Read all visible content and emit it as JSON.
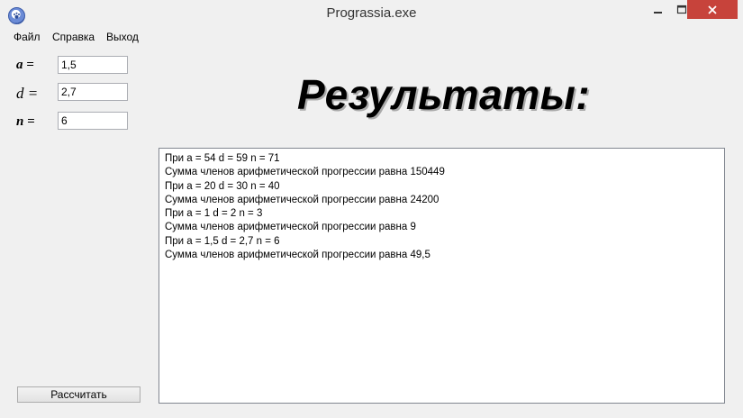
{
  "window": {
    "title": "Prograssia.exe"
  },
  "menu": {
    "items": [
      {
        "label": "Файл"
      },
      {
        "label": "Справка"
      },
      {
        "label": "Выход"
      }
    ]
  },
  "inputs": {
    "a": {
      "label": "a =",
      "value": "1,5"
    },
    "d": {
      "label": "d =",
      "value": "2,7"
    },
    "n": {
      "label": "n =",
      "value": "6"
    }
  },
  "results": {
    "heading": "Результаты:",
    "lines": [
      "При a = 54 d = 59 n = 71",
      "Сумма членов арифметической прогрессии равна 150449",
      "При a = 20 d = 30 n = 40",
      "Сумма членов арифметической прогрессии равна 24200",
      "При a = 1 d = 2 n = 3",
      "Сумма членов арифметической прогрессии равна 9",
      "При a = 1,5 d = 2,7 n = 6",
      "Сумма членов арифметической прогрессии равна 49,5"
    ]
  },
  "actions": {
    "calculate_label": "Рассчитать"
  },
  "colors": {
    "close_button": "#c7433b",
    "background": "#f0f0f0"
  }
}
